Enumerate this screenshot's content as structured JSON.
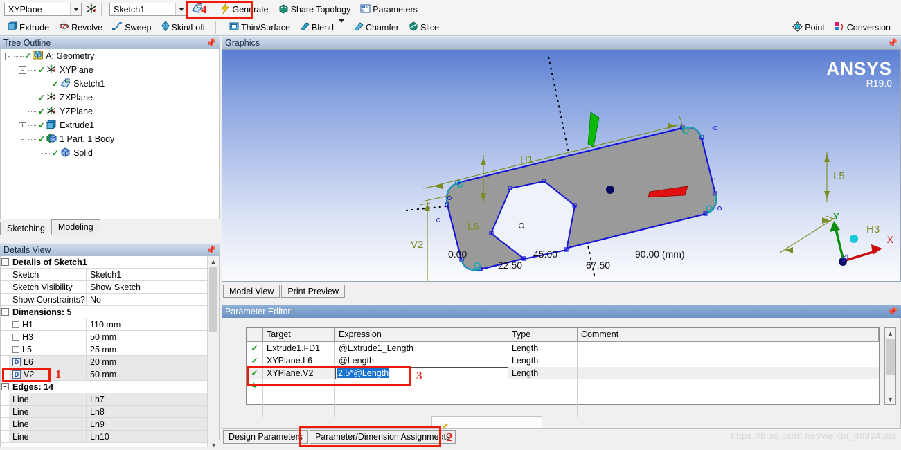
{
  "toolbar": {
    "plane_combo": {
      "value": "XYPlane",
      "icon": "plane-axis-icon"
    },
    "sketch_combo": {
      "value": "Sketch1",
      "icon": "new-sketch-icon"
    },
    "annotation_4": "4",
    "generate": {
      "label": "Generate",
      "icon": "lightning-icon"
    },
    "share_topology": {
      "label": "Share Topology",
      "icon": "share-topology-icon"
    },
    "parameters": {
      "label": "Parameters",
      "icon": "parameters-icon"
    },
    "row2": [
      {
        "label": "Extrude",
        "icon": "extrude-icon"
      },
      {
        "label": "Revolve",
        "icon": "revolve-icon"
      },
      {
        "label": "Sweep",
        "icon": "sweep-icon"
      },
      {
        "label": "Skin/Loft",
        "icon": "skin-loft-icon"
      },
      {
        "label": "Thin/Surface",
        "icon": "thin-surface-icon"
      },
      {
        "label": "Blend",
        "icon": "blend-icon"
      },
      {
        "label": "Chamfer",
        "icon": "chamfer-icon"
      },
      {
        "label": "Slice",
        "icon": "slice-icon"
      },
      {
        "label": "Point",
        "icon": "point-icon"
      },
      {
        "label": "Conversion",
        "icon": "conversion-icon"
      }
    ]
  },
  "tree": {
    "title": "Tree Outline",
    "items": [
      {
        "label": "A: Geometry",
        "indent": 0,
        "toggle": "-",
        "icon": "geometry-icon"
      },
      {
        "label": "XYPlane",
        "indent": 1,
        "toggle": "-",
        "icon": "plane-icon"
      },
      {
        "label": "Sketch1",
        "indent": 2,
        "toggle": "",
        "icon": "sketch-icon"
      },
      {
        "label": "ZXPlane",
        "indent": 1,
        "toggle": "",
        "icon": "plane-icon"
      },
      {
        "label": "YZPlane",
        "indent": 1,
        "toggle": "",
        "icon": "plane-icon"
      },
      {
        "label": "Extrude1",
        "indent": 1,
        "toggle": "+",
        "icon": "extrude-icon"
      },
      {
        "label": "1 Part, 1 Body",
        "indent": 1,
        "toggle": "-",
        "icon": "body-icon"
      },
      {
        "label": "Solid",
        "indent": 2,
        "toggle": "",
        "icon": "solid-icon"
      }
    ]
  },
  "sketch_tabs": [
    {
      "label": "Sketching",
      "active": false
    },
    {
      "label": "Modeling",
      "active": true
    }
  ],
  "details": {
    "title": "Details View",
    "rows": [
      {
        "kind": "header",
        "toggle": "-",
        "key": "Details of Sketch1",
        "value": ""
      },
      {
        "kind": "text",
        "key": "Sketch",
        "value": "Sketch1"
      },
      {
        "kind": "text",
        "key": "Sketch Visibility",
        "value": "Show Sketch"
      },
      {
        "kind": "text",
        "key": "Show Constraints?",
        "value": "No"
      },
      {
        "kind": "header",
        "toggle": "-",
        "key": "Dimensions: 5",
        "value": ""
      },
      {
        "kind": "check",
        "key": "H1",
        "value": "110 mm",
        "checked": false
      },
      {
        "kind": "check",
        "key": "H3",
        "value": "50 mm",
        "checked": false
      },
      {
        "kind": "check",
        "key": "L5",
        "value": "25 mm",
        "checked": false
      },
      {
        "kind": "driven",
        "key": "L6",
        "value": "20 mm",
        "badge": "D",
        "shaded": true
      },
      {
        "kind": "driven",
        "key": "V2",
        "value": "50 mm",
        "badge": "D",
        "shaded": true,
        "highlight": true,
        "note": "1"
      },
      {
        "kind": "header",
        "toggle": "-",
        "key": "Edges: 14",
        "value": ""
      },
      {
        "kind": "text",
        "key": "Line",
        "value": "Ln7",
        "shaded": true
      },
      {
        "kind": "text",
        "key": "Line",
        "value": "Ln8",
        "shaded": true
      },
      {
        "kind": "text",
        "key": "Line",
        "value": "Ln9",
        "shaded": true
      },
      {
        "kind": "text",
        "key": "Line",
        "value": "Ln10",
        "shaded": true
      }
    ]
  },
  "graphics": {
    "title": "Graphics",
    "logo": {
      "brand": "ANSYS",
      "release": "R19.0"
    },
    "dimension_labels": [
      "H1",
      "L5",
      "L6",
      "V2",
      "H3"
    ],
    "ruler": {
      "top_ticks": [
        "0.00",
        "45.00",
        "90.00 (mm)"
      ],
      "bottom_ticks": [
        "22.50",
        "67.50"
      ]
    },
    "triad": {
      "x_label": "X",
      "y_label": "Y"
    },
    "view_tabs": [
      {
        "label": "Model View",
        "active": true
      },
      {
        "label": "Print Preview",
        "active": false
      }
    ]
  },
  "parameter_editor": {
    "title": "Parameter Editor",
    "columns": [
      "",
      "Target",
      "Expression",
      "Type",
      "Comment",
      ""
    ],
    "rows": [
      {
        "mark": "check",
        "target": "Extrude1.FD1",
        "expression": "@Extrude1_Length",
        "type": "Length",
        "comment": ""
      },
      {
        "mark": "check",
        "target": "XYPlane.L6",
        "expression": "@Length",
        "type": "Length",
        "comment": ""
      },
      {
        "mark": "check",
        "target": "XYPlane.V2",
        "expression": "2.5*@Length",
        "type": "Length",
        "comment": "",
        "editing": true,
        "selected": true,
        "note": "3"
      },
      {
        "mark": "hash",
        "target": "",
        "expression": "",
        "type": "",
        "comment": ""
      },
      {
        "mark": "",
        "target": "",
        "expression": "",
        "type": "",
        "comment": ""
      },
      {
        "mark": "",
        "target": "",
        "expression": "",
        "type": "",
        "comment": ""
      }
    ],
    "tabs": [
      {
        "label": "Design Parameters",
        "active": false
      },
      {
        "label": "Parameter/Dimension Assignments",
        "active": true,
        "note": "2"
      }
    ]
  },
  "watermark": "https://blog.csdn.net/weixin_48924581",
  "colors": {
    "accent_blue": "#6d93c4",
    "annotation_red": "#f01a08",
    "check_green": "#0c9a12",
    "edit_select_blue": "#1775d1",
    "viewport_top": "#5a7ed2"
  }
}
